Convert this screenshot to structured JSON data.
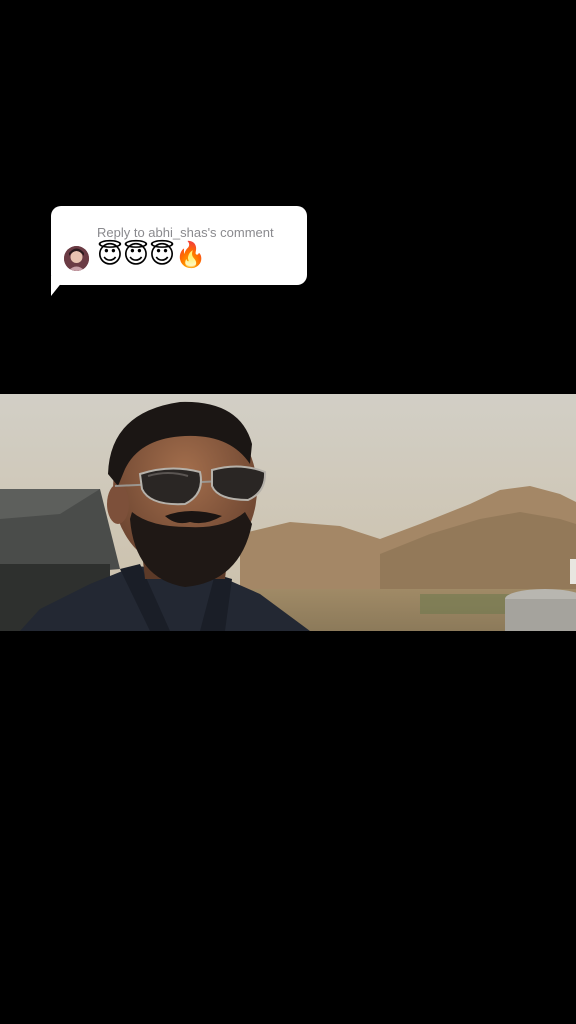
{
  "reply": {
    "title": "Reply to abhi_shas's comment",
    "comment_text": "😇😇😇🔥"
  },
  "colors": {
    "background": "#000000",
    "bubble": "#ffffff",
    "reply_title": "#8a8a8e"
  },
  "icons": {
    "avatar": "commenter-avatar"
  }
}
